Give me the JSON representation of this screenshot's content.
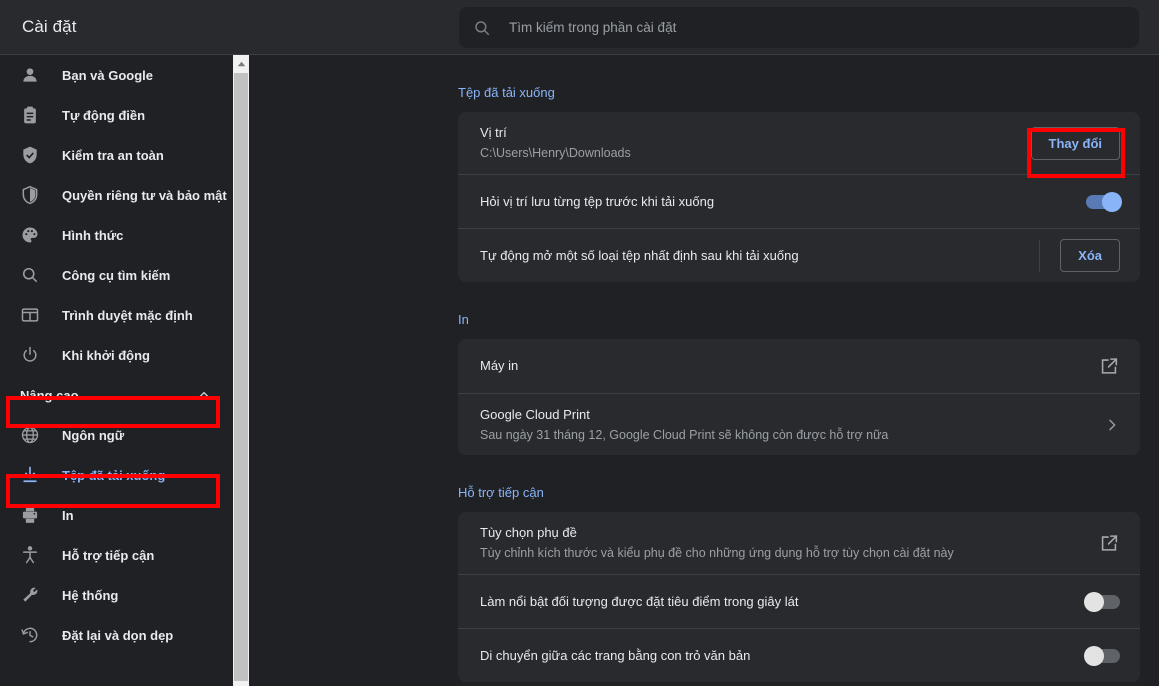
{
  "header": {
    "title": "Cài đặt",
    "search_placeholder": "Tìm kiếm trong phần cài đặt",
    "search_value": ""
  },
  "sidebar": {
    "items": [
      {
        "label": "Bạn và Google",
        "icon": "person-icon"
      },
      {
        "label": "Tự động điền",
        "icon": "clipboard-icon"
      },
      {
        "label": "Kiểm tra an toàn",
        "icon": "shield-check-icon"
      },
      {
        "label": "Quyền riêng tư và bảo mật",
        "icon": "shield-half-icon"
      },
      {
        "label": "Hình thức",
        "icon": "palette-icon"
      },
      {
        "label": "Công cụ tìm kiếm",
        "icon": "search-icon"
      },
      {
        "label": "Trình duyệt mặc định",
        "icon": "browser-icon"
      },
      {
        "label": "Khi khởi động",
        "icon": "power-icon"
      }
    ],
    "advanced_group": {
      "label": "Nâng cao",
      "icon": "chevron-up-icon",
      "expanded": true
    },
    "advanced_items": [
      {
        "label": "Ngôn ngữ",
        "icon": "globe-icon",
        "selected": false
      },
      {
        "label": "Tệp đã tải xuống",
        "icon": "download-icon",
        "selected": true
      },
      {
        "label": "In",
        "icon": "printer-icon",
        "selected": false
      },
      {
        "label": "Hỗ trợ tiếp cận",
        "icon": "accessibility-icon",
        "selected": false
      },
      {
        "label": "Hệ thống",
        "icon": "wrench-icon",
        "selected": false
      },
      {
        "label": "Đặt lại và dọn dẹp",
        "icon": "history-restore-icon",
        "selected": false
      }
    ]
  },
  "main": {
    "downloads": {
      "section_title": "Tệp đã tải xuống",
      "location_title": "Vị trí",
      "location_value": "C:\\Users\\Henry\\Downloads",
      "change_button": "Thay đổi",
      "ask_location_label": "Hỏi vị trí lưu từng tệp trước khi tải xuống",
      "ask_location_state": "on",
      "auto_open_label": "Tự động mở một số loại tệp nhất định sau khi tải xuống",
      "clear_button": "Xóa"
    },
    "print": {
      "section_title": "In",
      "printers_label": "Máy in",
      "cloud_print_title": "Google Cloud Print",
      "cloud_print_sub": "Sau ngày 31 tháng 12, Google Cloud Print sẽ không còn được hỗ trợ nữa"
    },
    "accessibility": {
      "section_title": "Hỗ trợ tiếp cận",
      "captions_title": "Tùy chọn phụ đề",
      "captions_sub": "Tùy chỉnh kích thước và kiểu phụ đề cho những ứng dụng hỗ trợ tùy chọn cài đặt này",
      "focus_highlight_label": "Làm nổi bật đối tượng được đặt tiêu điểm trong giây lát",
      "focus_highlight_state": "off",
      "caret_browsing_label": "Di chuyển giữa các trang bằng con trỏ văn bản",
      "caret_browsing_state": "off"
    }
  },
  "annotations": {
    "highlight_color": "#ff0000",
    "boxes": [
      "advanced-group",
      "downloads-nav-item",
      "change-location-button"
    ]
  },
  "colors": {
    "page_bg": "#202124",
    "card_bg": "#292a2d",
    "header_bg": "#292a2d",
    "accent_blue": "#8ab4f8",
    "text_primary": "#e8eaed",
    "text_secondary": "#9aa0a6"
  }
}
